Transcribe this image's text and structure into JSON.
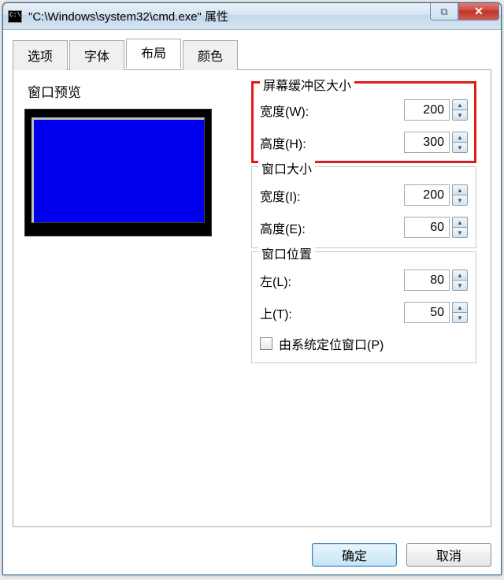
{
  "titlebar": {
    "title": "\"C:\\Windows\\system32\\cmd.exe\" 属性",
    "close_glyph": "✕",
    "help_glyph": "⧉"
  },
  "tabs": {
    "options": "选项",
    "font": "字体",
    "layout": "布局",
    "colors": "颜色"
  },
  "preview": {
    "label": "窗口预览"
  },
  "groups": {
    "buffer": {
      "title": "屏幕缓冲区大小",
      "width_label": "宽度(W):",
      "height_label": "高度(H):",
      "width_value": "200",
      "height_value": "300"
    },
    "window": {
      "title": "窗口大小",
      "width_label": "宽度(I):",
      "height_label": "高度(E):",
      "width_value": "200",
      "height_value": "60"
    },
    "position": {
      "title": "窗口位置",
      "left_label": "左(L):",
      "top_label": "上(T):",
      "left_value": "80",
      "top_value": "50",
      "checkbox_label": "由系统定位窗口(P)"
    }
  },
  "buttons": {
    "ok": "确定",
    "cancel": "取消"
  }
}
